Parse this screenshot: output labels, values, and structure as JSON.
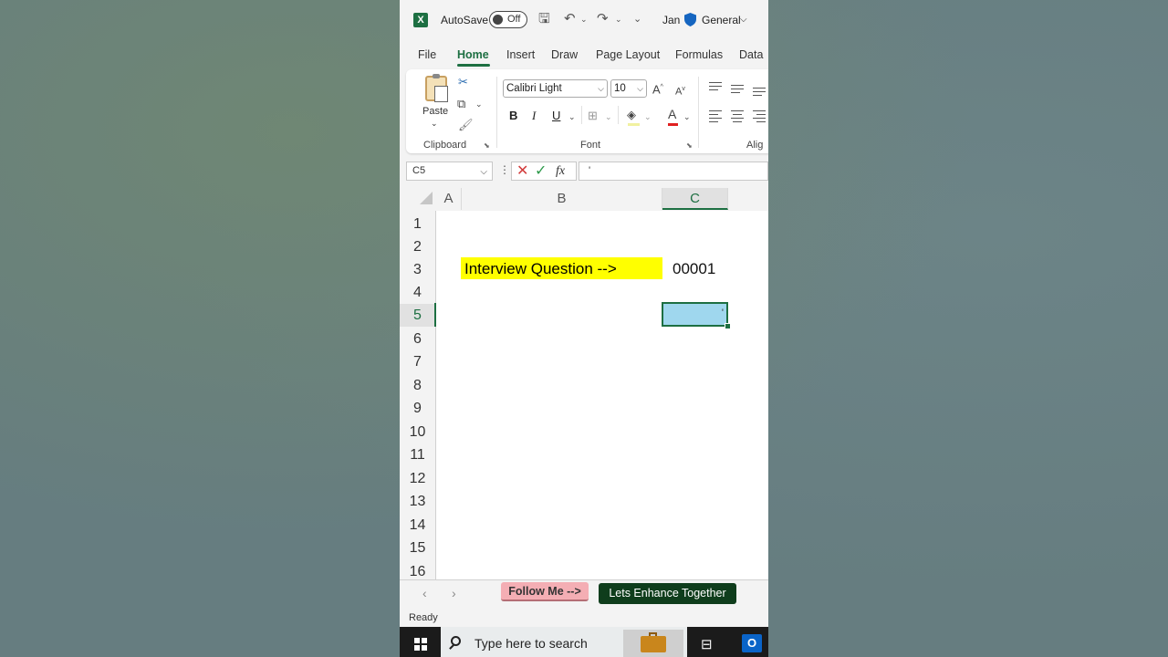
{
  "titlebar": {
    "autosave_label": "AutoSave",
    "autosave_state": "Off",
    "user_name": "Jan",
    "sensitivity": "General"
  },
  "tabs": [
    "File",
    "Home",
    "Insert",
    "Draw",
    "Page Layout",
    "Formulas",
    "Data"
  ],
  "active_tab": "Home",
  "ribbon": {
    "paste_label": "Paste",
    "clipboard_group": "Clipboard",
    "font_group": "Font",
    "alignment_group": "Alig",
    "font_name": "Calibri Light",
    "font_size": "10",
    "bold": "B",
    "italic": "I",
    "underline": "U"
  },
  "formula_bar": {
    "name_box": "C5",
    "fx": "fx",
    "content": "'"
  },
  "columns": [
    "A",
    "B",
    "C"
  ],
  "selected_column": "C",
  "rows": [
    "1",
    "2",
    "3",
    "4",
    "5",
    "6",
    "7",
    "8",
    "9",
    "10",
    "11",
    "12",
    "13",
    "14",
    "15",
    "16"
  ],
  "selected_row": "5",
  "cells": {
    "B3": "Interview Question -->",
    "C3": "00001",
    "C5": "'"
  },
  "sheet_tabs": [
    "Follow Me -->",
    "Lets Enhance Together"
  ],
  "status": "Ready",
  "taskbar": {
    "search_placeholder": "Type here to search"
  },
  "colors": {
    "excel_green": "#1d6f42",
    "highlight_yellow": "#ffff00",
    "selected_cell_fill": "#9fd7ee",
    "sheet_tab_pink": "#f4aeb4",
    "sheet_tab_dark_green": "#0f3d1c"
  }
}
